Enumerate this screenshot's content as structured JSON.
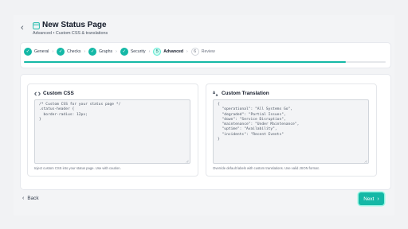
{
  "header": {
    "title": "New Status Page",
    "subtitle": "Advanced • Custom CSS & translations"
  },
  "steps": [
    {
      "label": "General",
      "state": "done",
      "marker": "✓"
    },
    {
      "label": "Checks",
      "state": "done",
      "marker": "✓"
    },
    {
      "label": "Graphs",
      "state": "done",
      "marker": "✓"
    },
    {
      "label": "Security",
      "state": "done",
      "marker": "✓"
    },
    {
      "label": "Advanced",
      "state": "active",
      "marker": "5"
    },
    {
      "label": "Review",
      "state": "todo",
      "marker": "6"
    }
  ],
  "progress": 0.89,
  "css_panel": {
    "title": "Custom CSS",
    "icon": "code-icon",
    "code": "/* Custom CSS for your status page */\n.status-header {\n  border-radius: 12px;\n}",
    "help": "Inject custom CSS into your status page. Use with caution."
  },
  "translation_panel": {
    "title": "Custom Translation",
    "icon": "translate-icon",
    "code": "{\n  \"operational\": \"All Systems Go\",\n  \"degraded\": \"Partial Issues\",\n  \"down\": \"Service Disruption\",\n  \"maintenance\": \"Under Maintenance\",\n  \"uptime\": \"Availability\",\n  \"incidents\": \"Recent Events\"\n}",
    "help": "Override default labels with custom translations. Use valid JSON format."
  },
  "footer": {
    "back_label": "Back",
    "next_label": "Next"
  },
  "colors": {
    "accent": "#14b8a6",
    "background": "#f1f2f4"
  }
}
